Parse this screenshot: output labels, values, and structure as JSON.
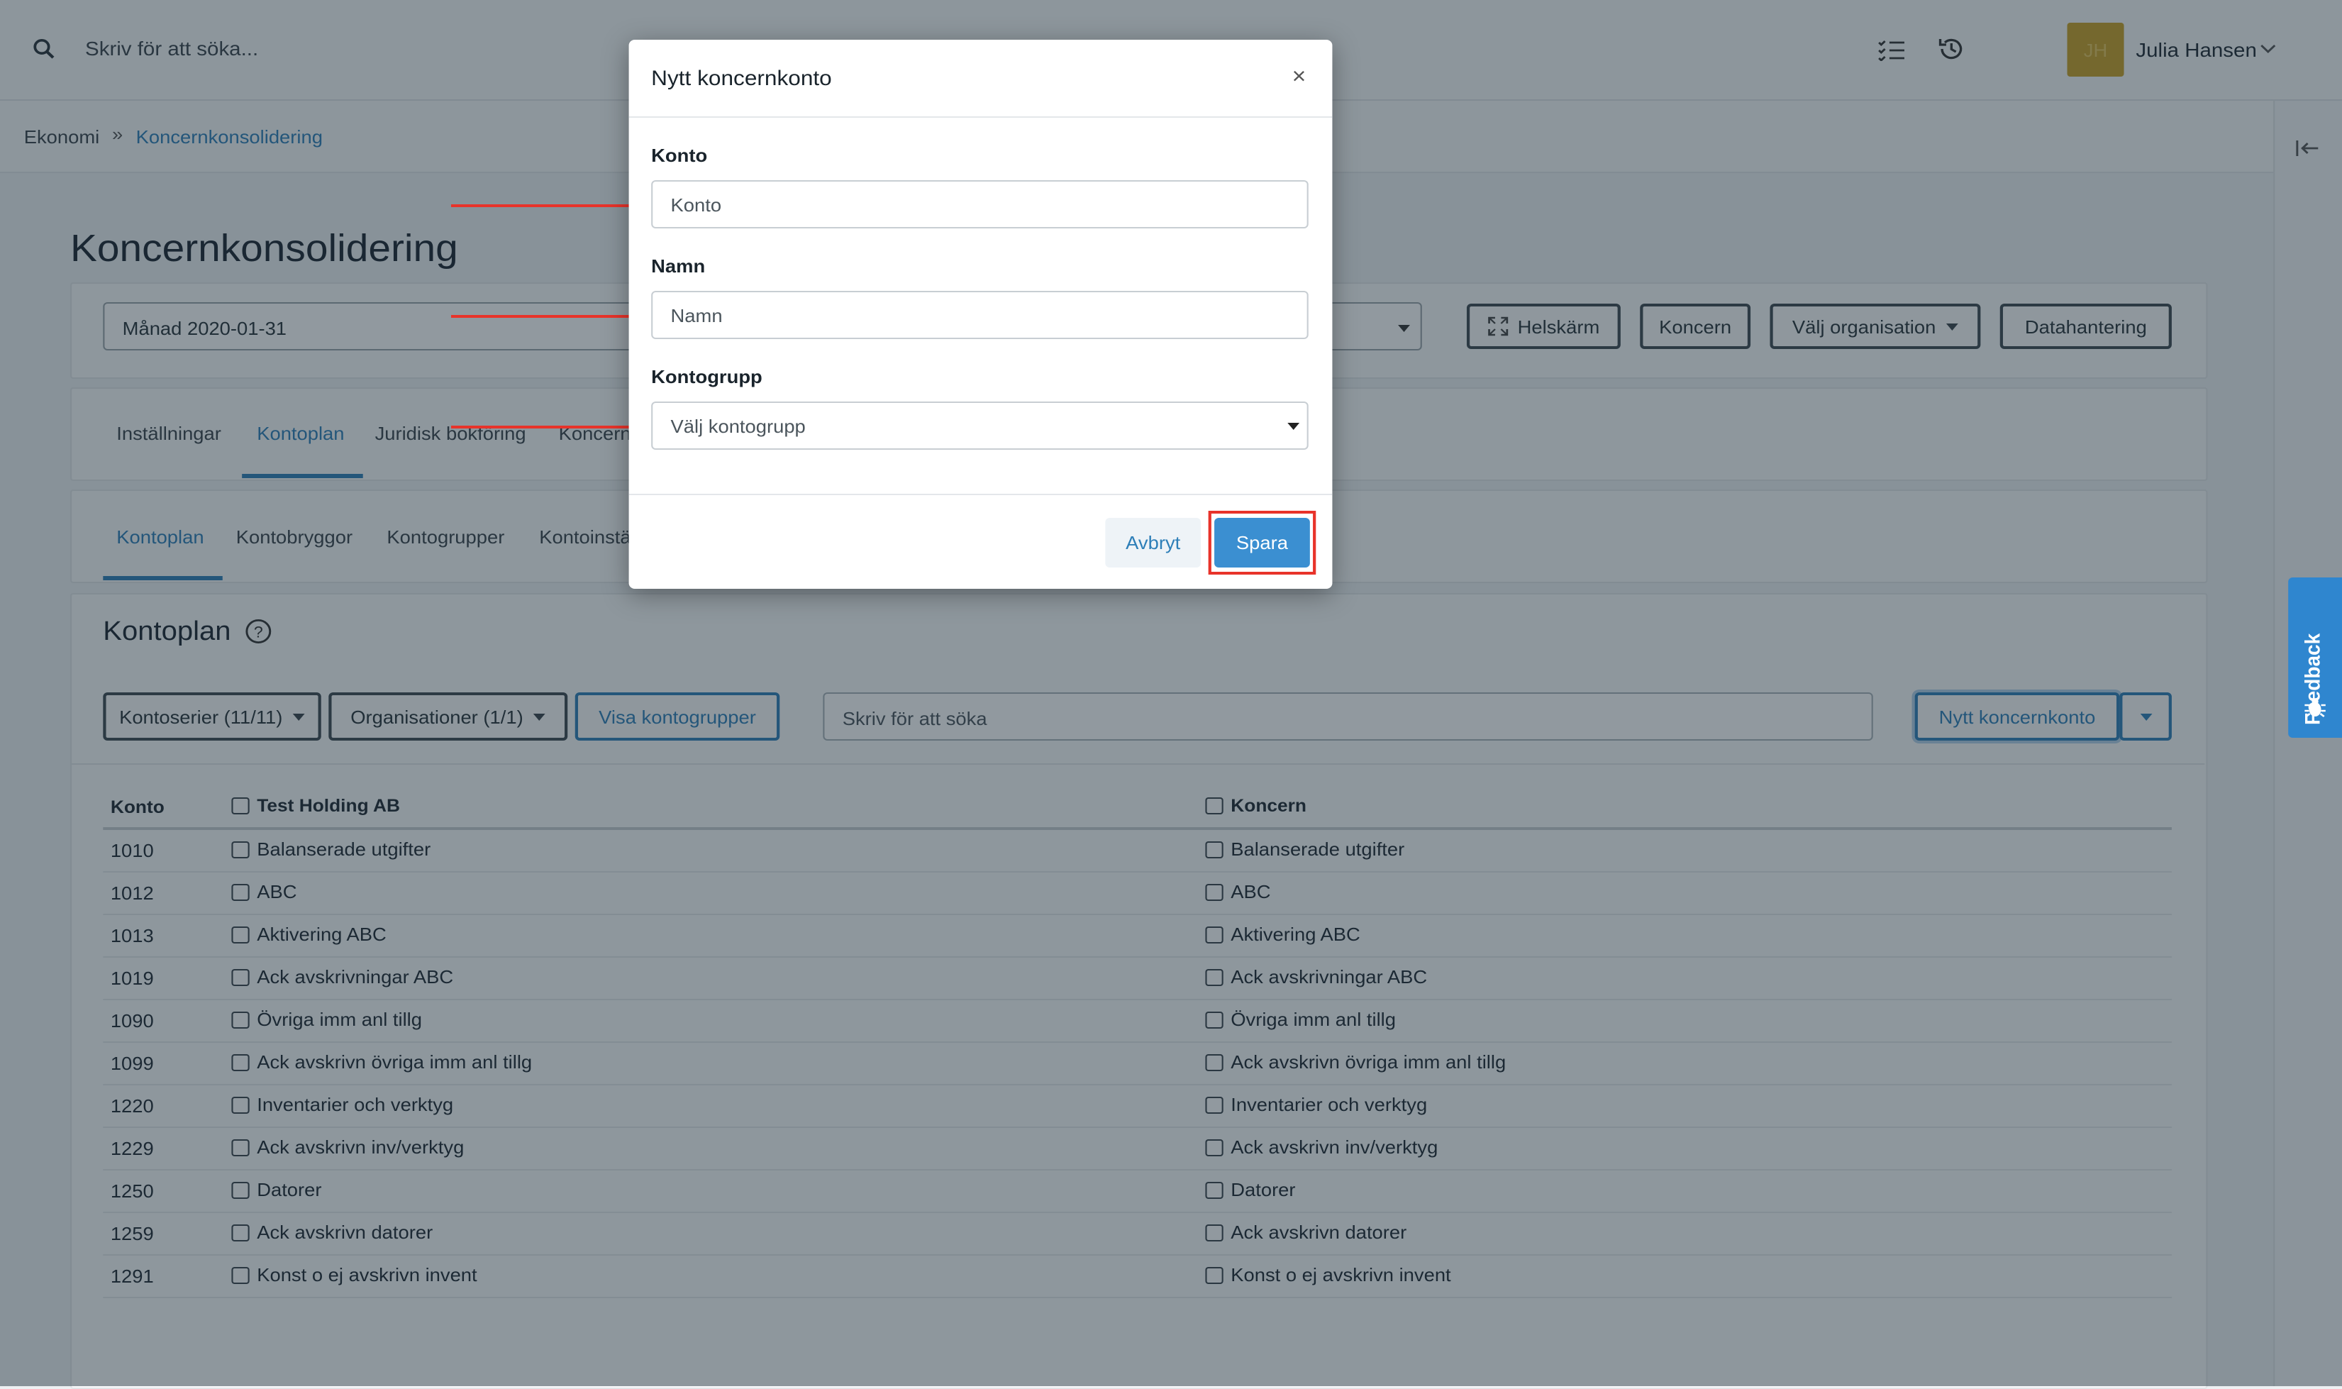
{
  "header": {
    "search_placeholder": "Skriv för att söka...",
    "user_initials": "JH",
    "user_name": "Julia Hansen"
  },
  "breadcrumb": {
    "root": "Ekonomi",
    "current": "Koncernkonsolidering"
  },
  "page_title": "Koncernkonsolidering",
  "toolbar": {
    "period": "Månad 2020-01-31",
    "fullscreen": "Helskärm",
    "group": "Koncern",
    "select_org": "Välj organisation",
    "data_handling": "Datahantering"
  },
  "main_tabs": [
    "Inställningar",
    "Kontoplan",
    "Juridisk bokföring",
    "Koncern"
  ],
  "sub_tabs": [
    "Kontoplan",
    "Kontobryggor",
    "Kontogrupper",
    "Kontoinstä"
  ],
  "section_title": "Kontoplan",
  "filters": {
    "series": "Kontoserier (11/11)",
    "organisations": "Organisationer (1/1)",
    "show_groups": "Visa kontogrupper",
    "search_placeholder": "Skriv för att söka",
    "new_group_account": "Nytt koncernkonto"
  },
  "table": {
    "columns": [
      "Konto",
      "Test Holding AB",
      "Koncern"
    ],
    "rows": [
      {
        "konto": "1010",
        "name": "Balanserade utgifter"
      },
      {
        "konto": "1012",
        "name": "ABC"
      },
      {
        "konto": "1013",
        "name": "Aktivering ABC"
      },
      {
        "konto": "1019",
        "name": "Ack avskrivningar ABC"
      },
      {
        "konto": "1090",
        "name": "Övriga imm anl tillg"
      },
      {
        "konto": "1099",
        "name": "Ack avskrivn övriga imm anl tillg"
      },
      {
        "konto": "1220",
        "name": "Inventarier och verktyg"
      },
      {
        "konto": "1229",
        "name": "Ack avskrivn inv/verktyg"
      },
      {
        "konto": "1250",
        "name": "Datorer"
      },
      {
        "konto": "1259",
        "name": "Ack avskrivn datorer"
      },
      {
        "konto": "1291",
        "name": "Konst o ej avskrivn invent"
      }
    ]
  },
  "modal": {
    "title": "Nytt koncernkonto",
    "close": "×",
    "konto_label": "Konto",
    "konto_placeholder": "Konto",
    "namn_label": "Namn",
    "namn_placeholder": "Namn",
    "group_label": "Kontogrupp",
    "group_placeholder": "Välj kontogrupp",
    "cancel": "Avbryt",
    "save": "Spara"
  },
  "feedback": "Feedback",
  "colors": {
    "accent": "#2e7fb8",
    "primary_button": "#3b8fd1",
    "highlight": "#e8332a",
    "avatar": "#c9a227"
  }
}
